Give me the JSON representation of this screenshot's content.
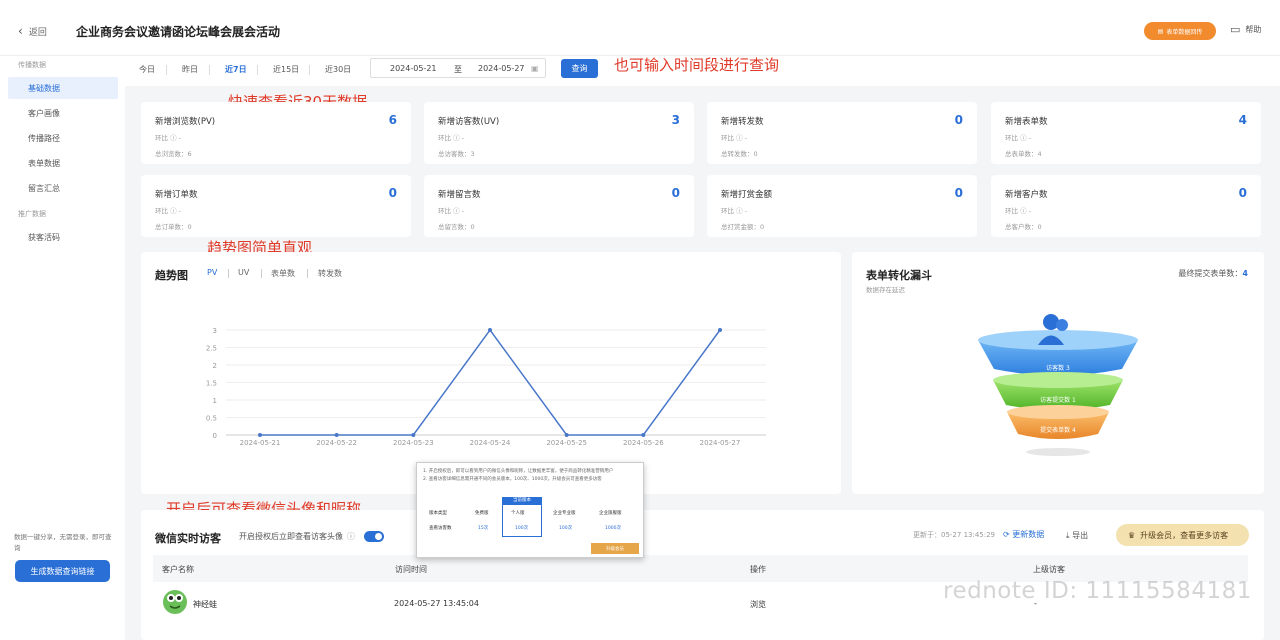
{
  "header": {
    "back_label": "返回",
    "title": "企业商务会议邀请函论坛峰会展会活动",
    "tag_label": "表单数据回传",
    "help_label": "帮助"
  },
  "sidebar": {
    "group1": "传播数据",
    "items": [
      "基础数据",
      "客户画像",
      "传播路径",
      "表单数据",
      "留言汇总"
    ],
    "group2": "推广数据",
    "items2": [
      "获客活码"
    ],
    "note": "数据一键分享，无需登录，即可查询",
    "button": "生成数据查询链接"
  },
  "filter": {
    "ranges": [
      "今日",
      "昨日",
      "近7日",
      "近15日",
      "近30日"
    ],
    "active_range": "近7日",
    "start_date": "2024-05-21",
    "to_label": "至",
    "end_date": "2024-05-27",
    "query_label": "查询"
  },
  "annotations": {
    "query_hint": "也可输入时间段进行查询",
    "range_hint": "快速查看近30天数据",
    "trend_hint": "趋势图简单直观",
    "wechat_hint": "开启后可查看微信头像和昵称"
  },
  "stats": [
    {
      "label": "新增浏览数(PV)",
      "value": "6",
      "ratio": "环比 ⓘ -",
      "total": "总浏览数：6"
    },
    {
      "label": "新增访客数(UV)",
      "value": "3",
      "ratio": "环比 ⓘ -",
      "total": "总访客数：3"
    },
    {
      "label": "新增转发数",
      "value": "0",
      "ratio": "环比 ⓘ -",
      "total": "总转发数：0"
    },
    {
      "label": "新增表单数",
      "value": "4",
      "ratio": "环比 ⓘ -",
      "total": "总表单数：4"
    },
    {
      "label": "新增订单数",
      "value": "0",
      "ratio": "环比 ⓘ -",
      "total": "总订单数：0"
    },
    {
      "label": "新增留言数",
      "value": "0",
      "ratio": "环比 ⓘ -",
      "total": "总留言数：0"
    },
    {
      "label": "新增打赏金额",
      "value": "0",
      "ratio": "环比 ⓘ -",
      "total": "总打赏金额：0"
    },
    {
      "label": "新增客户数",
      "value": "0",
      "ratio": "环比 ⓘ -",
      "total": "总客户数：0"
    }
  ],
  "trend": {
    "title": "趋势图",
    "tabs": [
      "PV",
      "UV",
      "表单数",
      "转发数"
    ],
    "active_tab": "PV"
  },
  "chart_data": {
    "type": "line",
    "x": [
      "2024-05-21",
      "2024-05-22",
      "2024-05-23",
      "2024-05-24",
      "2024-05-25",
      "2024-05-26",
      "2024-05-27"
    ],
    "y_ticks": [
      "0",
      "0.5",
      "1",
      "1.5",
      "2",
      "2.5",
      "3"
    ],
    "series": [
      {
        "values": [
          0,
          0,
          0,
          3,
          0,
          0,
          3
        ],
        "color": "#4a78c9"
      }
    ],
    "ylim": [
      0,
      3
    ],
    "grid": true
  },
  "funnel": {
    "title": "表单转化漏斗",
    "subtitle": "数据存在延迟",
    "last_label": "最终提交表单数：",
    "last_value": "4",
    "levels": [
      {
        "label": "访客数 3",
        "color": "#3f95e8"
      },
      {
        "label": "访客提交数 1",
        "color": "#62c93a"
      },
      {
        "label": "提交表单数 4",
        "color": "#f19a3b"
      }
    ]
  },
  "realtime": {
    "title": "微信实时访客",
    "desc": "开启授权后立即查看访客头像",
    "update": "更新于：05-27 13:45:29",
    "refresh": "更新数据",
    "export": "导出",
    "upgrade": "升级会员，查看更多访客",
    "columns": [
      "客户名称",
      "访问时间",
      "操作",
      "上级访客"
    ],
    "rows": [
      {
        "name": "神经蛙",
        "time": "2024-05-27 13:45:04",
        "action": "浏览",
        "parent": "-"
      }
    ]
  },
  "popup": {
    "line1": "1. 开启授权后，即可以看到用户的微信头像和昵称，让数据更丰富，便于商品转化精准营销用户",
    "line2": "2. 查看访客详细信息需开通不同的会员版本，100次、1000次，升级会员可查看更多访客",
    "current_tag": "当前版本",
    "headers": [
      "版本类型",
      "免费版",
      "个人版",
      "企业专业版",
      "企业旗舰版"
    ],
    "row_label": "查看访客数",
    "row_values": [
      "15次",
      "100次",
      "100次",
      "1000次"
    ],
    "button": "升级会员"
  },
  "watermark": "rednote ID: 11115584181"
}
